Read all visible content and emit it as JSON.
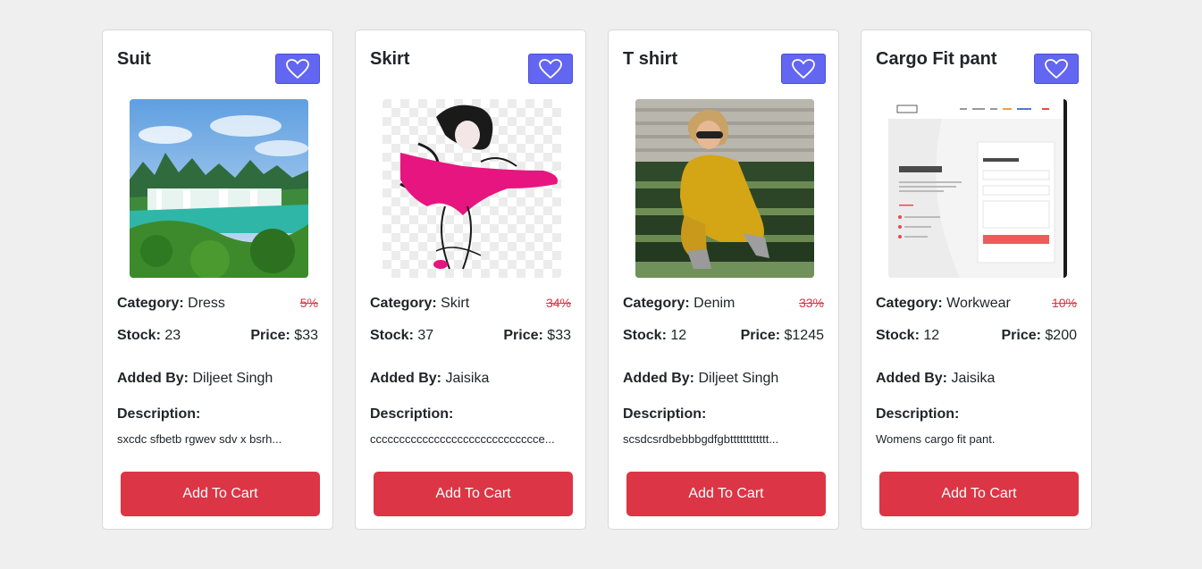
{
  "labels": {
    "category": "Category:",
    "stock": "Stock:",
    "price": "Price:",
    "added_by": "Added By:",
    "description": "Description:",
    "add_to_cart": "Add To Cart"
  },
  "colors": {
    "favorite_button": "#6366f1",
    "cart_button": "#dc3545",
    "discount": "#dc3545"
  },
  "icons": {
    "favorite": "heart-icon"
  },
  "products": [
    {
      "name": "Suit",
      "image": "landscape-waterfall-photo",
      "category": "Dress",
      "discount": "5%",
      "stock": "23",
      "price": "$33",
      "added_by": "Diljeet Singh",
      "description": "sxcdc sfbetb rgwev sdv x bsrh..."
    },
    {
      "name": "Skirt",
      "image": "fashion-sketch-illustration",
      "category": "Skirt",
      "discount": "34%",
      "stock": "37",
      "price": "$33",
      "added_by": "Jaisika",
      "description": "ccccccccccccccccccccccccccccce..."
    },
    {
      "name": "T shirt",
      "image": "woman-yellow-outfit-photo",
      "category": "Denim",
      "discount": "33%",
      "stock": "12",
      "price": "$1245",
      "added_by": "Diljeet Singh",
      "description": "scsdcsrdbebbbgdfgbtttttttttttt..."
    },
    {
      "name": "Cargo Fit pant",
      "image": "website-contact-page-screenshot",
      "category": "Workwear",
      "discount": "10%",
      "stock": "12",
      "price": "$200",
      "added_by": "Jaisika",
      "description": "Womens cargo fit pant."
    }
  ]
}
